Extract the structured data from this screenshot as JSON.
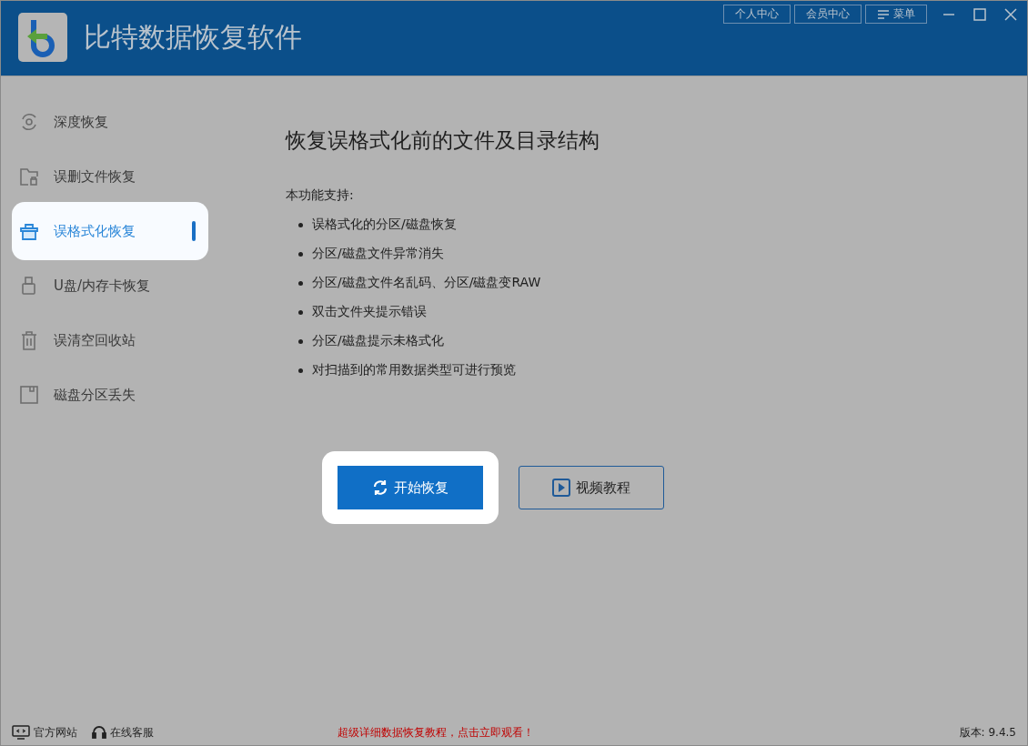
{
  "window": {
    "title": "比特数据恢复软件",
    "header_buttons": [
      "个人中心",
      "会员中心",
      "菜单"
    ]
  },
  "sidebar": {
    "items": [
      {
        "label": "深度恢复",
        "kind": "disc",
        "selected": false
      },
      {
        "label": "误删文件恢复",
        "kind": "folder",
        "selected": false
      },
      {
        "label": "误格式化恢复",
        "kind": "box",
        "selected": true
      },
      {
        "label": "U盘/内存卡恢复",
        "kind": "usb",
        "selected": false
      },
      {
        "label": "误清空回收站",
        "kind": "trash",
        "selected": false
      },
      {
        "label": "磁盘分区丢失",
        "kind": "disk",
        "selected": false
      }
    ]
  },
  "content": {
    "heading": "恢复误格式化前的文件及目录结构",
    "intro": "本功能支持:",
    "features": [
      "误格式化的分区/磁盘恢复",
      "分区/磁盘文件异常消失",
      "分区/磁盘文件名乱码、分区/磁盘变RAW",
      "双击文件夹提示错误",
      "分区/磁盘提示未格式化",
      "对扫描到的常用数据类型可进行预览"
    ],
    "start_button": "开始恢复",
    "video_button": "视频教程"
  },
  "status_bar": {
    "website": "官方网站",
    "support": "在线客服",
    "promo": "超级详细数据恢复教程，点击立即观看！",
    "version": "版本: 9.4.5"
  }
}
